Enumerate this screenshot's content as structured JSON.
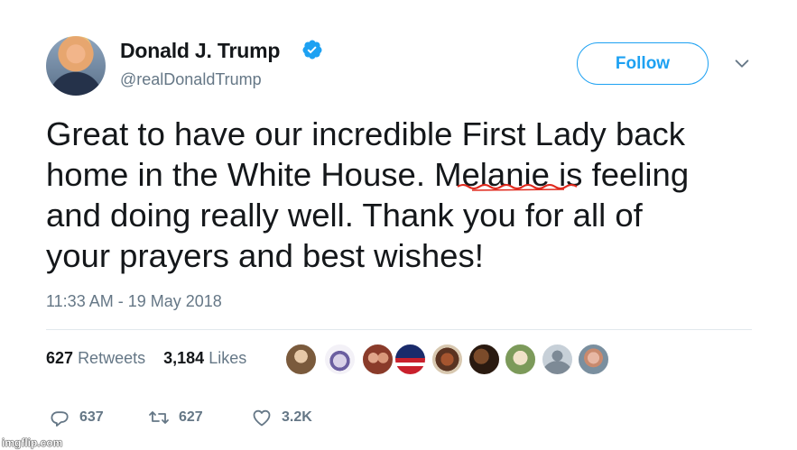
{
  "user": {
    "name": "Donald J. Trump",
    "handle": "@realDonaldTrump"
  },
  "follow_label": "Follow",
  "tweet": {
    "lines": [
      "Great to have our incredible First Lady back",
      "home in the White House. Melanie is feeling",
      "and doing really well. Thank you for all of",
      "your prayers and best wishes!"
    ],
    "timestamp": "11:33 AM - 19 May 2018"
  },
  "stats": {
    "retweets_count": "627",
    "retweets_label": "Retweets",
    "likes_count": "3,184",
    "likes_label": "Likes"
  },
  "actions": {
    "replies": "637",
    "retweets": "627",
    "likes": "3.2K"
  },
  "watermark": "imgflip.com",
  "colors": {
    "accent": "#1da1f2",
    "muted": "#657786",
    "text": "#14171a",
    "spellcheck": "#e0281c"
  },
  "icons": [
    "verified-badge-icon",
    "chevron-down-icon",
    "reply-icon",
    "retweet-icon",
    "like-icon"
  ]
}
